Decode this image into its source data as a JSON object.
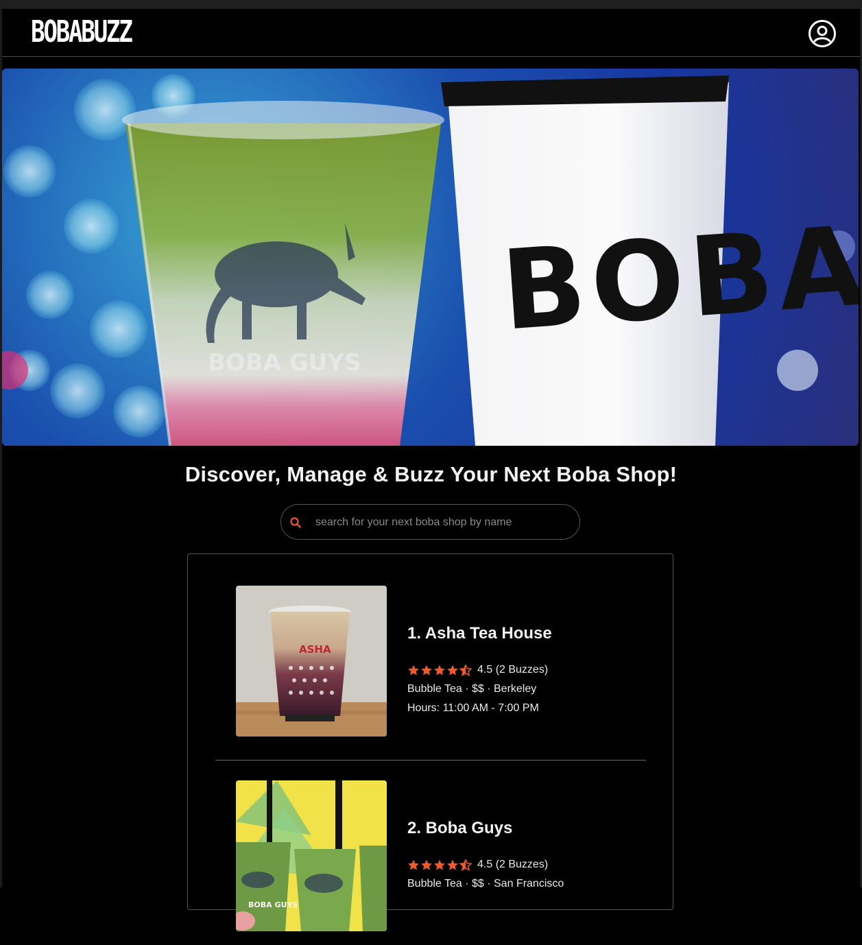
{
  "app": {
    "brand": "BOBABUZZ"
  },
  "hero": {
    "cup_text": "BOBA",
    "cup_brand": "BOBA GUYS"
  },
  "main": {
    "headline": "Discover, Manage & Buzz Your Next Boba Shop!",
    "search": {
      "placeholder": "search for your next boba shop by name",
      "value": ""
    }
  },
  "shops": [
    {
      "name": "1. Asha Tea House",
      "rating": 4.5,
      "rating_text": "4.5 (2 Buzzes)",
      "category": "Bubble Tea",
      "price": "$$",
      "city": "Berkeley",
      "meta_text": "Bubble Tea · $$ · Berkeley",
      "hours": "Hours: 11:00 AM - 7:00 PM",
      "cup_label": "ASHA"
    },
    {
      "name": "2. Boba Guys",
      "rating": 4.5,
      "rating_text": "4.5 (2 Buzzes)",
      "category": "Bubble Tea",
      "price": "$$",
      "city": "San Francisco",
      "meta_text": "Bubble Tea · $$ · San Francisco",
      "cup_label": "BOBA GUYS"
    }
  ],
  "colors": {
    "accent": "#f05a28",
    "background": "#000000",
    "border": "#555555"
  }
}
